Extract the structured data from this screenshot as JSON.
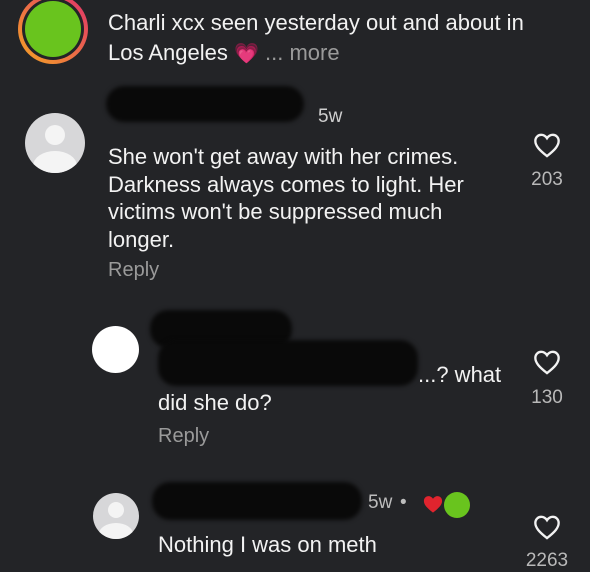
{
  "caption": {
    "username": "Charli xcx",
    "text_line1": " seen yesterday out and about in",
    "text_line2": "Los Angeles ",
    "emoji": "💗",
    "more": " ... more"
  },
  "comments": [
    {
      "time": "5w",
      "text": "She won't get away with her crimes. Darkness always comes to light. Her victims won't be suppressed much longer.",
      "reply": "Reply",
      "likes": "203"
    },
    {
      "text_tail": "...? what",
      "text_line2": "did she do?",
      "reply": "Reply",
      "likes": "130"
    },
    {
      "time": "5w",
      "separator": "•",
      "text": "Nothing I was on meth",
      "likes": "2263"
    }
  ],
  "colors": {
    "background": "#232427",
    "text": "#f2f2f2",
    "secondary": "#9a9a9a",
    "story_green": "#69c41e",
    "heart_red": "#e0242e"
  }
}
